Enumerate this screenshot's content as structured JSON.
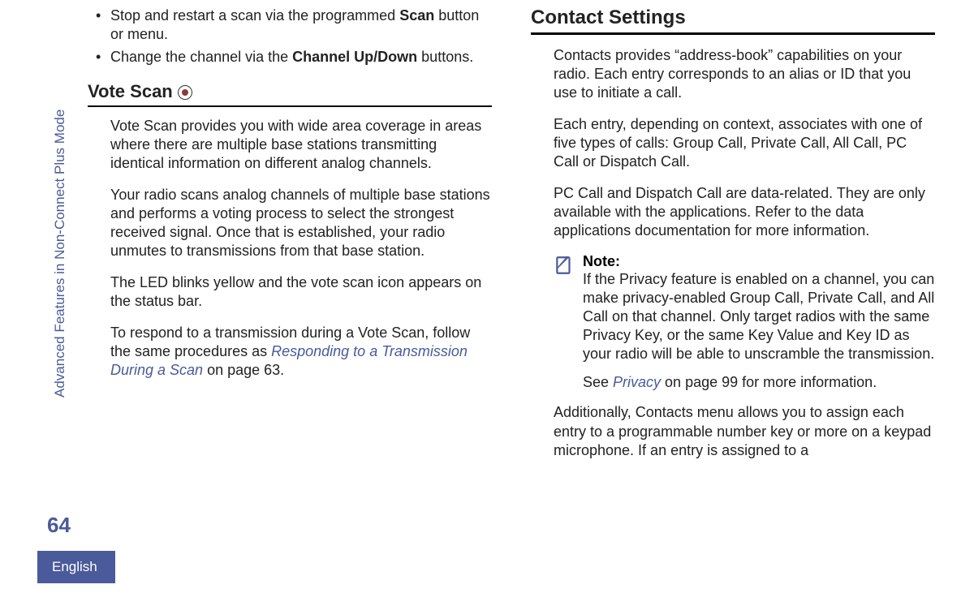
{
  "sidebar": {
    "chapter": "Advanced Features in Non-Connect Plus Mode"
  },
  "page_number": "64",
  "language": "English",
  "left": {
    "bullets": [
      {
        "pre": "Stop and restart a scan via the programmed ",
        "bold": "Scan",
        "post": " button or menu."
      },
      {
        "pre": "Change the channel via the ",
        "bold": "Channel Up/Down",
        "post": " buttons."
      }
    ],
    "heading": "Vote Scan",
    "p1": "Vote Scan provides you with wide area coverage in areas where there are multiple base stations transmitting identical information on different analog channels.",
    "p2": "Your radio scans analog channels of multiple base stations and performs a voting process to select the strongest received signal. Once that is established, your radio unmutes to transmissions from that base station.",
    "p3": "The LED blinks yellow and the vote scan icon appears on the status bar.",
    "p4_pre": "To respond to a transmission during a Vote Scan, follow the same procedures as ",
    "p4_link": "Responding to a Transmission During a Scan",
    "p4_post": " on page 63."
  },
  "right": {
    "heading": "Contact Settings",
    "p1": "Contacts provides “address-book” capabilities on your radio. Each entry corresponds to an alias or ID that you use to initiate a call.",
    "p2": "Each entry, depending on context, associates with one of five types of calls: Group Call, Private Call, All Call, PC Call or Dispatch Call.",
    "p3": "PC Call and Dispatch Call are data-related. They are only available with the applications. Refer to the data applications documentation for more information.",
    "note": {
      "label": "Note:",
      "text1": "If the Privacy feature is enabled on a channel, you can make privacy-enabled Group Call, Private Call, and All Call on that channel. Only target radios with the same Privacy Key, or the same Key Value and Key ID as your radio will be able to unscramble the transmission.",
      "text2_pre": "See ",
      "text2_link": "Privacy",
      "text2_post": " on page 99 for more information."
    },
    "p4": "Additionally, Contacts menu allows you to assign each entry to a programmable number key or more on a keypad microphone. If an entry is assigned to a"
  }
}
